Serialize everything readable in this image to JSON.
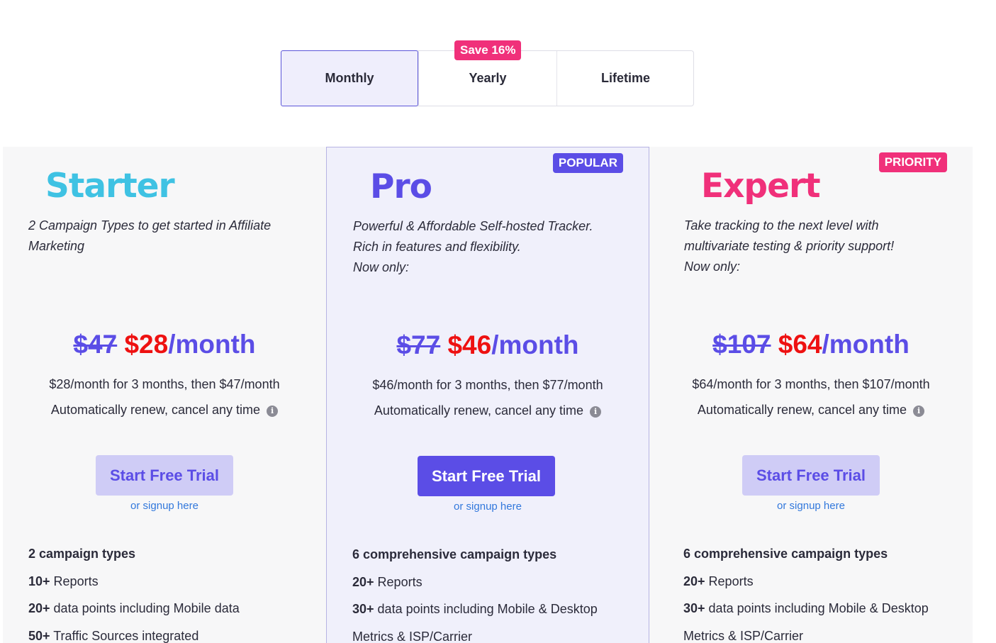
{
  "billing_toggle": {
    "tabs": [
      {
        "label": "Monthly",
        "active": true
      },
      {
        "label": "Yearly",
        "active": false,
        "badge": "Save 16%"
      },
      {
        "label": "Lifetime",
        "active": false
      }
    ]
  },
  "plans": [
    {
      "name": "Starter",
      "name_color": "#3fc2e3",
      "badge": "",
      "description": [
        "2 Campaign Types to get started in Affiliate",
        "Marketing"
      ],
      "old_price": "$47",
      "new_price": "$28",
      "per": "/month",
      "price_note": "$28/month for 3 months, then $47/month",
      "renew_note": "Automatically renew, cancel any time",
      "cta": "Start Free Trial",
      "signup": "or signup here",
      "features": [
        {
          "bold": "2 campaign types",
          "text": ""
        },
        {
          "bold": "10+",
          "text": " Reports"
        },
        {
          "bold": "20+",
          "text": " data points including Mobile data"
        },
        {
          "bold": "50+",
          "text": " Traffic Sources integrated"
        }
      ]
    },
    {
      "name": "Pro",
      "name_color": "#5b4de6",
      "badge": "POPULAR",
      "description": [
        "Powerful & Affordable Self-hosted Tracker.",
        "Rich in features and flexibility.",
        "Now only:"
      ],
      "old_price": "$77",
      "new_price": "$46",
      "per": "/month",
      "price_note": "$46/month for 3 months, then $77/month",
      "renew_note": "Automatically renew, cancel any time",
      "cta": "Start Free Trial",
      "signup": "or signup here",
      "features": [
        {
          "bold": "6 comprehensive campaign types",
          "text": ""
        },
        {
          "bold": "20+",
          "text": " Reports"
        },
        {
          "bold": "30+",
          "text": " data points including Mobile & Desktop"
        },
        {
          "bold": "",
          "text": "Metrics & ISP/Carrier"
        }
      ]
    },
    {
      "name": "Expert",
      "name_color": "#f0307a",
      "badge": "PRIORITY",
      "description": [
        "Take tracking to the next level with",
        "multivariate testing & priority support!",
        "Now only:"
      ],
      "old_price": "$107",
      "new_price": "$64",
      "per": "/month",
      "price_note": "$64/month for 3 months, then $107/month",
      "renew_note": "Automatically renew, cancel any time",
      "cta": "Start Free Trial",
      "signup": "or signup here",
      "features": [
        {
          "bold": "6 comprehensive campaign types",
          "text": ""
        },
        {
          "bold": "20+",
          "text": " Reports"
        },
        {
          "bold": "30+",
          "text": " data points including Mobile & Desktop"
        },
        {
          "bold": "",
          "text": "Metrics & ISP/Carrier"
        }
      ]
    }
  ],
  "colors": {
    "accent": "#5b4de6",
    "pink": "#f0307a",
    "cyan": "#3fc2e3",
    "sale_red": "#ee1111",
    "link": "#3278dc"
  }
}
